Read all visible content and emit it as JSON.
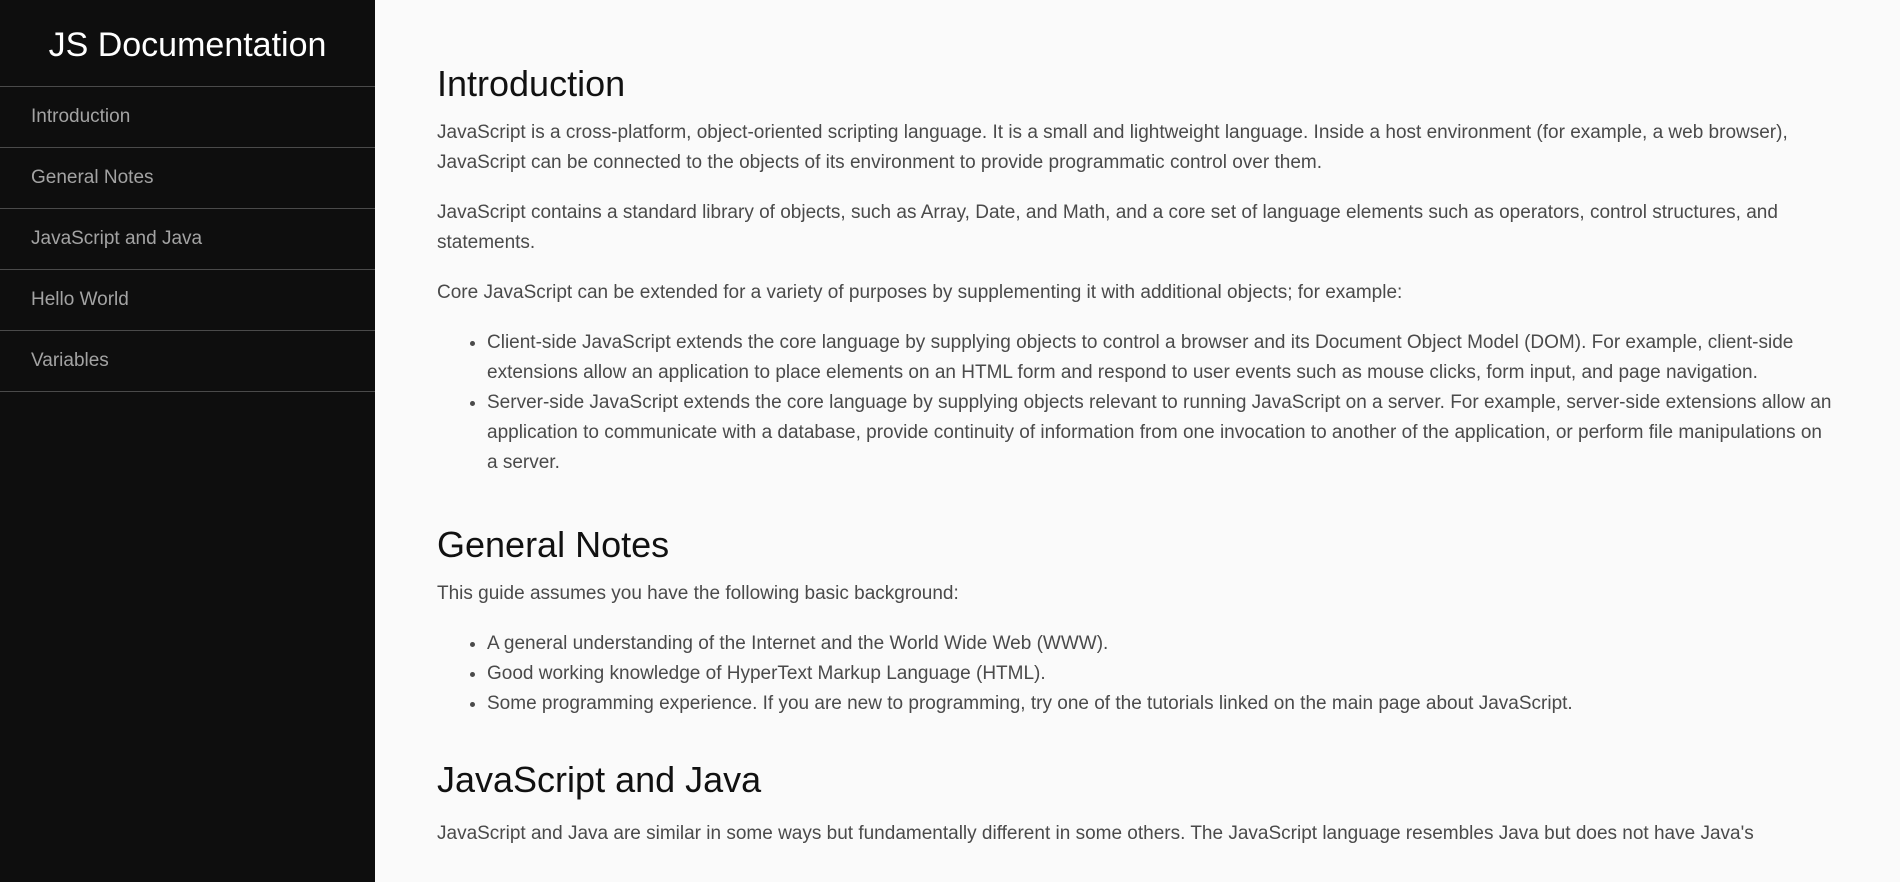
{
  "nav": {
    "title": "JS Documentation",
    "items": [
      {
        "label": "Introduction"
      },
      {
        "label": "General Notes"
      },
      {
        "label": "JavaScript and Java"
      },
      {
        "label": "Hello World"
      },
      {
        "label": "Variables"
      }
    ]
  },
  "sections": {
    "introduction": {
      "heading": "Introduction",
      "paragraphs": [
        "JavaScript is a cross-platform, object-oriented scripting language. It is a small and lightweight language. Inside a host environment (for example, a web browser), JavaScript can be connected to the objects of its environment to provide programmatic control over them.",
        "JavaScript contains a standard library of objects, such as Array, Date, and Math, and a core set of language elements such as operators, control structures, and statements.",
        "Core JavaScript can be extended for a variety of purposes by supplementing it with additional objects; for example:"
      ],
      "list": [
        "Client-side JavaScript extends the core language by supplying objects to control a browser and its Document Object Model (DOM). For example, client-side extensions allow an application to place elements on an HTML form and respond to user events such as mouse clicks, form input, and page navigation.",
        "Server-side JavaScript extends the core language by supplying objects relevant to running JavaScript on a server. For example, server-side extensions allow an application to communicate with a database, provide continuity of information from one invocation to another of the application, or perform file manipulations on a server."
      ]
    },
    "general_notes": {
      "heading": "General Notes",
      "paragraphs": [
        "This guide assumes you have the following basic background:"
      ],
      "list": [
        "A general understanding of the Internet and the World Wide Web (WWW).",
        "Good working knowledge of HyperText Markup Language (HTML).",
        "Some programming experience. If you are new to programming, try one of the tutorials linked on the main page about JavaScript."
      ]
    },
    "javascript_and_java": {
      "heading": "JavaScript and Java",
      "paragraphs": [
        "JavaScript and Java are similar in some ways but fundamentally different in some others. The JavaScript language resembles Java but does not have Java's"
      ]
    }
  }
}
